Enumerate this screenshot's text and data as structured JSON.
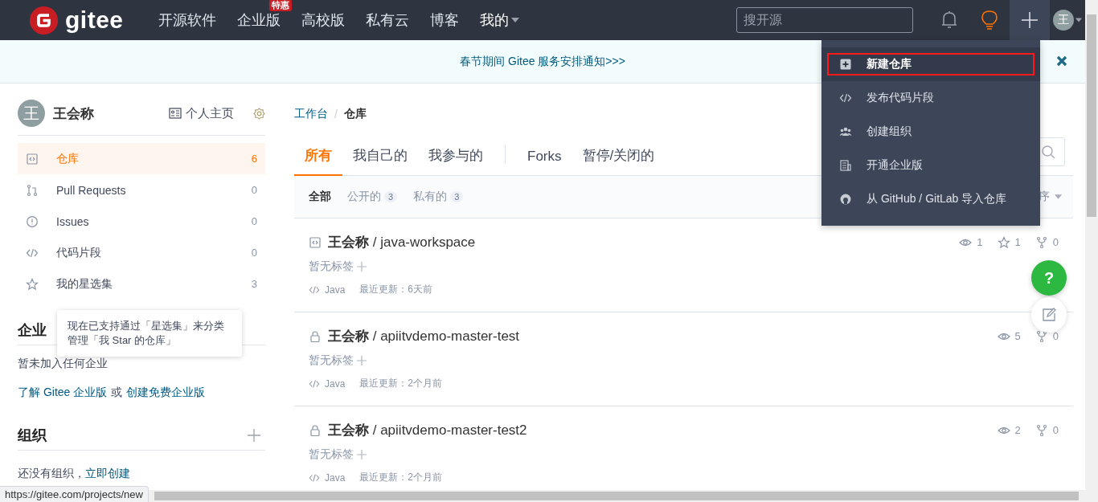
{
  "nav": {
    "logo": "gitee",
    "items": [
      {
        "label": "开源软件"
      },
      {
        "label": "企业版",
        "badge": "特惠"
      },
      {
        "label": "高校版"
      },
      {
        "label": "私有云"
      },
      {
        "label": "博客"
      }
    ],
    "me": "我的",
    "search": {
      "placeholder": "搜开源"
    },
    "avatar": "王"
  },
  "banner": {
    "text": "春节期间 Gitee 服务安排通知>>>"
  },
  "sidebar": {
    "avatar": "王",
    "name": "王会称",
    "home": "个人主页",
    "items": [
      {
        "kind": "repo",
        "label": "仓库",
        "count": "6",
        "selected": true
      },
      {
        "kind": "pr",
        "label": "Pull Requests",
        "count": "0",
        "selected": false
      },
      {
        "kind": "issue",
        "label": "Issues",
        "count": "0",
        "selected": false
      },
      {
        "kind": "code",
        "label": "代码片段",
        "count": "0",
        "selected": false
      },
      {
        "kind": "star",
        "label": "我的星选集",
        "count": "3",
        "selected": false
      }
    ],
    "tooltip": "现在已支持通过「星选集」来分类管理「我 Star 的仓库」",
    "enterprise": {
      "title": "企业",
      "empty": "暂未加入任何企业",
      "link1": "了解 Gitee 企业版",
      "or": "或",
      "link2": "创建免费企业版"
    },
    "org": {
      "title": "组织",
      "empty": "还没有组织，",
      "link": "立即创建"
    }
  },
  "main": {
    "breadcrumb": [
      "工作台",
      "仓库"
    ],
    "breadcrumb_sep": "/",
    "tabs": [
      {
        "label": "所有",
        "selected": true
      },
      {
        "label": "我自己的",
        "selected": false
      },
      {
        "label": "我参与的",
        "selected": false
      },
      {
        "label": "Forks",
        "selected": false
      },
      {
        "label": "暂停/关闭的",
        "selected": false
      }
    ],
    "filters": [
      {
        "label": "全部",
        "selected": true
      },
      {
        "label": "公开的",
        "count": "3",
        "selected": false
      },
      {
        "label": "私有的",
        "count": "3",
        "selected": false
      }
    ],
    "sort_label": "序",
    "repos": [
      {
        "private": false,
        "title": "**王会称** / java-workspace",
        "tag": "暂无标签",
        "lang": "Java",
        "updated": "最近更新：6天前",
        "watch": "1",
        "stars": "1",
        "forks": "0"
      },
      {
        "private": true,
        "title": "**王会称** / apiitvdemo-master-test",
        "tag": "暂无标签",
        "lang": "Java",
        "updated": "最近更新：2个月前",
        "watch": "5",
        "forks": "0"
      },
      {
        "private": true,
        "title": "**王会称** / apiitvdemo-master-test2",
        "tag": "暂无标签",
        "lang": "Java",
        "updated": "最近更新：2个月前",
        "watch": "2",
        "forks": "0"
      }
    ]
  },
  "help": "?",
  "dropdown": [
    {
      "kind": "plus",
      "label": "新建仓库",
      "selected": true
    },
    {
      "kind": "code",
      "label": "发布代码片段",
      "selected": false
    },
    {
      "kind": "group",
      "label": "创建组织",
      "selected": false
    },
    {
      "kind": "building",
      "label": "开通企业版",
      "selected": false
    },
    {
      "kind": "github",
      "label": "从 GitHub / GitLab 导入仓库",
      "selected": false
    }
  ],
  "status_url": "https://gitee.com/projects/new"
}
